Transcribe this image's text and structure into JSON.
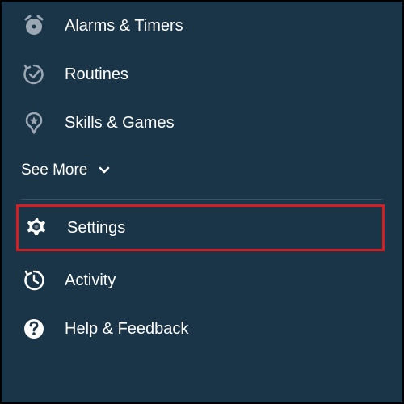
{
  "menu": {
    "items": [
      {
        "label": "Alarms & Timers",
        "icon": "alarm-icon"
      },
      {
        "label": "Routines",
        "icon": "routines-icon"
      },
      {
        "label": "Skills & Games",
        "icon": "skills-icon"
      }
    ],
    "see_more_label": "See More",
    "settings_label": "Settings",
    "activity_label": "Activity",
    "help_label": "Help & Feedback"
  },
  "colors": {
    "background": "#1a3448",
    "text": "#ffffff",
    "icon": "#9ba8b3",
    "highlight_border": "#d51d22"
  }
}
